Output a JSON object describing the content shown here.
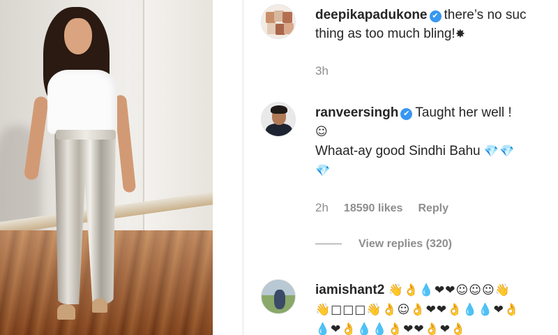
{
  "comments": [
    {
      "username": "deepikapadukone",
      "verified_glyph": "✔",
      "text_line1": "there’s no suc",
      "text_line2": "thing as too much bling!",
      "emoji_line2": "✸",
      "time": "3h"
    },
    {
      "username": "ranveersingh",
      "verified_glyph": "✔",
      "text_line1": "Taught her well !",
      "emoji_line2": "☺",
      "text_line3": "Whaat-ay good Sindhi Bahu",
      "emoji_line3": "💎💎",
      "emoji_line4": "💎",
      "time": "2h",
      "likes": "18590 likes",
      "reply": "Reply",
      "view_replies": "View replies (320)"
    },
    {
      "username": "iamishant2",
      "emoji_line1": "👋👌💧❤❤☺☺☺👋",
      "emoji_line2": "👋□□□👋👌☺👌❤❤👌💧💧❤👌",
      "emoji_line3": "💧❤👌💧💧👌❤❤👌❤👌"
    }
  ],
  "colors": {
    "text": "#262626",
    "muted": "#8e8e8e",
    "verified": "#3897f0"
  },
  "icons": [
    "verified-badge-icon",
    "avatar-deepikapadukone",
    "avatar-ranveersingh",
    "avatar-iamishant2"
  ]
}
